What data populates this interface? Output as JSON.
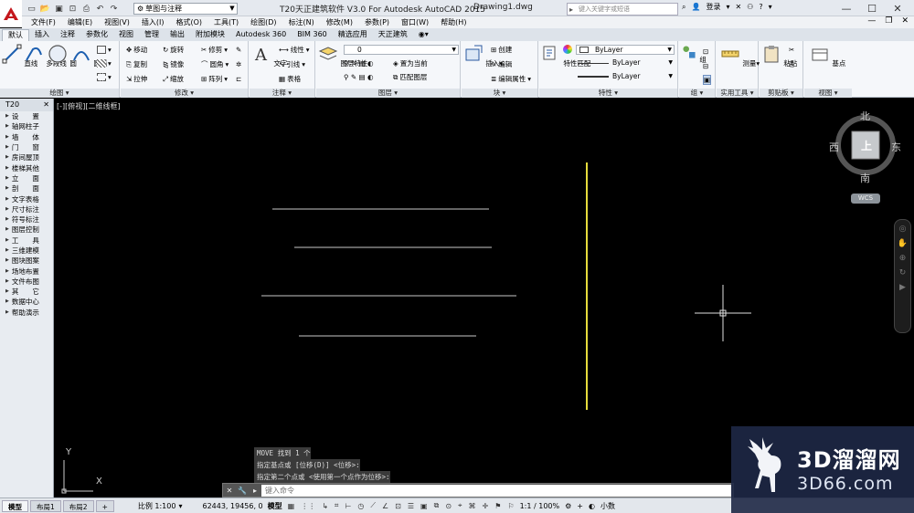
{
  "title_bar": {
    "app_title": "T20天正建筑软件 V3.0 For Autodesk AutoCAD 2015",
    "doc_title": "Drawing1.dwg",
    "workspace": "草图与注释",
    "search_placeholder": "键入关键字或短语",
    "login_label": "登录"
  },
  "menu": [
    "文件(F)",
    "编辑(E)",
    "视图(V)",
    "插入(I)",
    "格式(O)",
    "工具(T)",
    "绘图(D)",
    "标注(N)",
    "修改(M)",
    "参数(P)",
    "窗口(W)",
    "帮助(H)"
  ],
  "ribbon_tabs": [
    "默认",
    "插入",
    "注释",
    "参数化",
    "视图",
    "管理",
    "输出",
    "附加模块",
    "Autodesk 360",
    "BIM 360",
    "精选应用",
    "天正建筑"
  ],
  "ribbon": {
    "draw": {
      "title": "绘图",
      "line": "直线",
      "polyline": "多段线",
      "circle": "圆",
      "arc": "圆弧"
    },
    "modify": {
      "title": "修改",
      "move": "移动",
      "rotate": "旋转",
      "trim": "修剪",
      "copy": "复制",
      "mirror": "镜像",
      "fillet": "圆角",
      "stretch": "拉伸",
      "scale": "缩放",
      "array": "阵列"
    },
    "annotation": {
      "title": "注释",
      "text": "文字",
      "dimension": "线性",
      "leader": "引线",
      "table": "表格"
    },
    "layers": {
      "title": "图层",
      "layer_props": "图层特性",
      "current_layer": "0",
      "make_current": "置为当前",
      "match_layer": "匹配图层"
    },
    "block": {
      "title": "块",
      "insert": "插入",
      "create": "创建",
      "edit": "编辑",
      "edit_attr": "编辑属性"
    },
    "properties": {
      "title": "特性",
      "match": "特性匹配",
      "color": "ByLayer",
      "linetype": "ByLayer",
      "lineweight": "ByLayer"
    },
    "groups": {
      "title": "组",
      "group": "组"
    },
    "utilities": {
      "title": "实用工具",
      "measure": "测量"
    },
    "clipboard": {
      "title": "剪贴板",
      "paste": "粘贴"
    },
    "view": {
      "title": "视图",
      "base": "基点"
    }
  },
  "palette": {
    "title": "T20",
    "items": [
      "设　　置",
      "轴网柱子",
      "墙　　体",
      "门　　窗",
      "房间屋顶",
      "楼梯其他",
      "立　　面",
      "剖　　面",
      "文字表格",
      "尺寸标注",
      "符号标注",
      "图层控制",
      "工　　具",
      "三维建模",
      "图块图案",
      "场地布置",
      "文件布图",
      "其　　它",
      "数据中心",
      "帮助演示"
    ]
  },
  "viewport": {
    "view_label": "[-][俯视][二维线框]",
    "compass": {
      "north": "北",
      "south": "南",
      "east": "东",
      "west": "西",
      "top": "上"
    },
    "wcs": "WCS",
    "ucs_x": "X",
    "ucs_y": "Y",
    "colors": {
      "line": "#c8c8c8",
      "selected_line": "#e6dc3c",
      "background": "#000000"
    }
  },
  "command": {
    "history": [
      "MOVE 找到 1 个",
      "指定基点或 [位移(D)] <位移>:",
      "指定第二个点或 <使用第一个点作为位移>:"
    ],
    "placeholder": "键入命令"
  },
  "statusbar": {
    "tabs": [
      "模型",
      "布局1",
      "布局2"
    ],
    "scale": "比例 1:100",
    "coords": "62443, 19456, 0",
    "model": "模型",
    "annotation_scale": "1:1 / 100%",
    "decimal": "小数"
  },
  "watermark": {
    "line1": "3D溜溜网",
    "line2": "3D66.com"
  }
}
